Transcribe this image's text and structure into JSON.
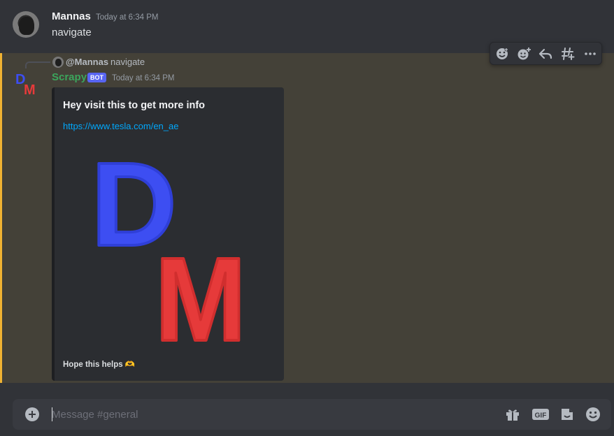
{
  "colors": {
    "background": "#313338",
    "mention_highlight": "#444138",
    "mention_bar": "#f0b232",
    "bot_name": "#3ba55c",
    "bot_tag": "#5865f2",
    "link": "#00a8fc",
    "logo_d": "#3d4ef2",
    "logo_m": "#e63a3a"
  },
  "message_1": {
    "author": "Mannas",
    "timestamp": "Today at 6:34 PM",
    "text": "navigate"
  },
  "message_2": {
    "reply_author": "@Mannas",
    "reply_text": "navigate",
    "author": "Scrapy",
    "bot_tag": "BOT",
    "timestamp": "Today at 6:34 PM",
    "avatar_letters": {
      "d": "D",
      "m": "M"
    },
    "embed": {
      "title": "Hey visit this to get more info",
      "link": "https://www.tesla.com/en_ae",
      "image_letters": {
        "d": "D",
        "m": "M"
      },
      "footer": "Hope this helps 🫶"
    }
  },
  "toolbar": {
    "icons": [
      "add-super-reaction-icon",
      "add-reaction-icon",
      "reply-icon",
      "create-thread-icon",
      "more-icon"
    ]
  },
  "composer": {
    "placeholder": "Message #general",
    "icons": [
      "add-attachment-icon",
      "gift-icon",
      "gif-icon",
      "sticker-icon",
      "emoji-icon"
    ],
    "gif_label": "GIF"
  }
}
